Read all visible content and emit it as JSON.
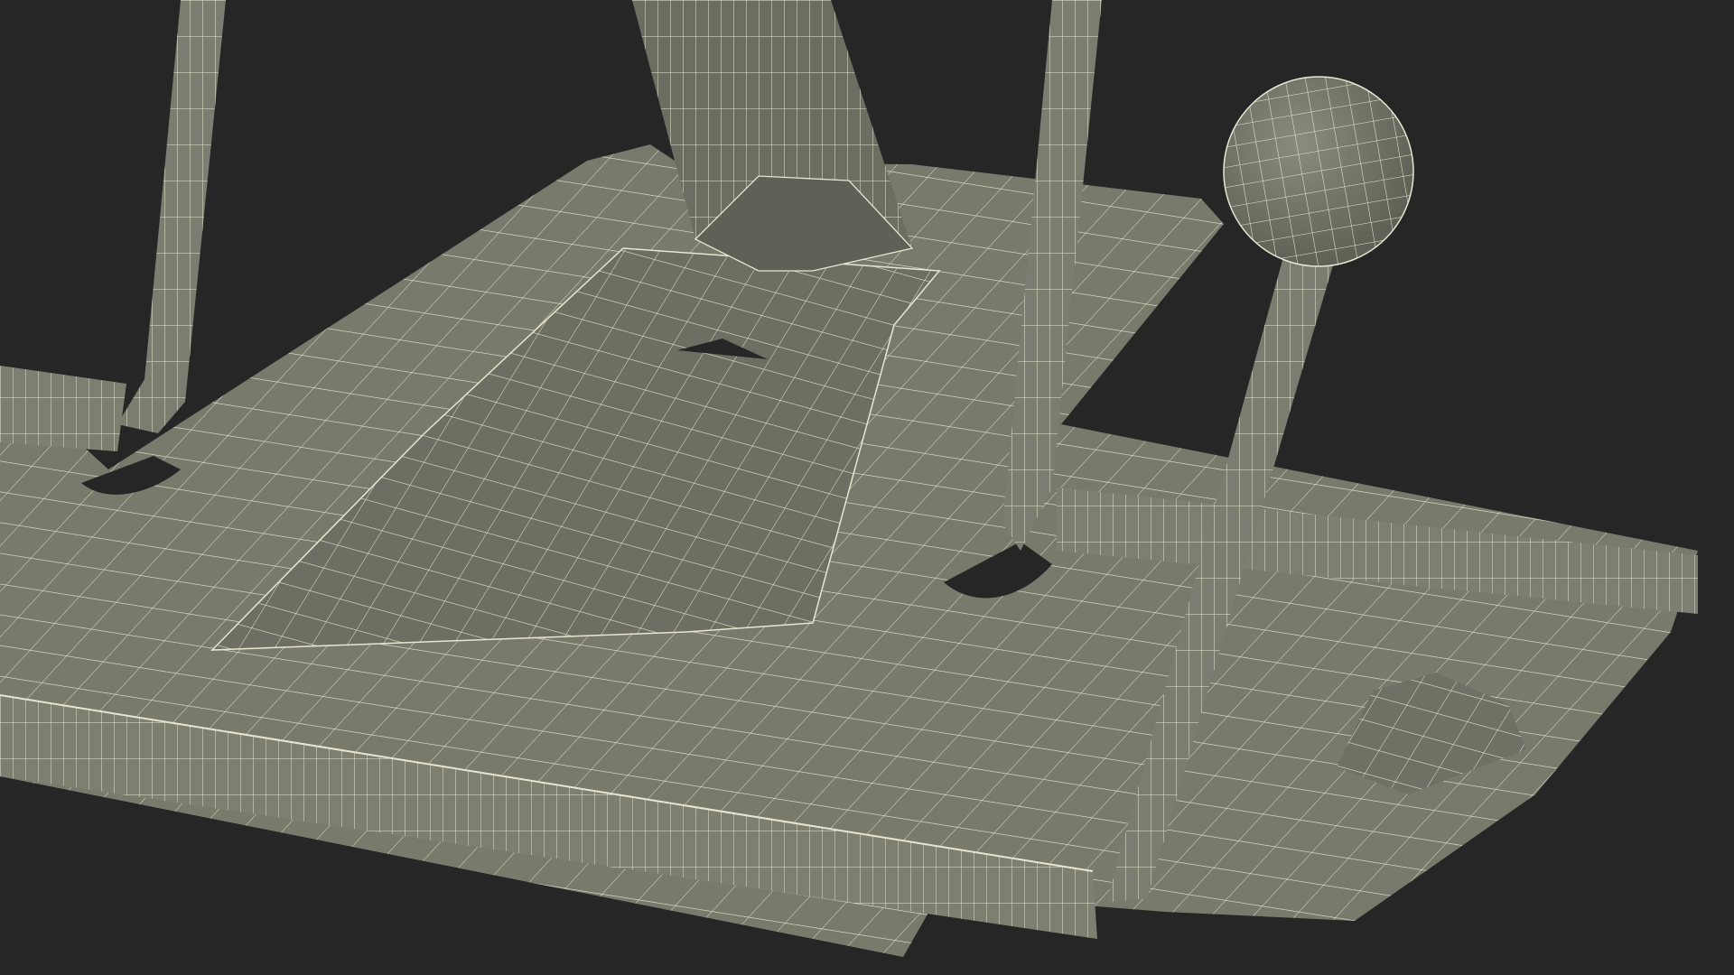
{
  "scene": {
    "background_color": "#262626",
    "mesh_color": "#787a6c",
    "mesh_shadow_color": "#5e6055",
    "wire_color": "#e8e6d2"
  }
}
